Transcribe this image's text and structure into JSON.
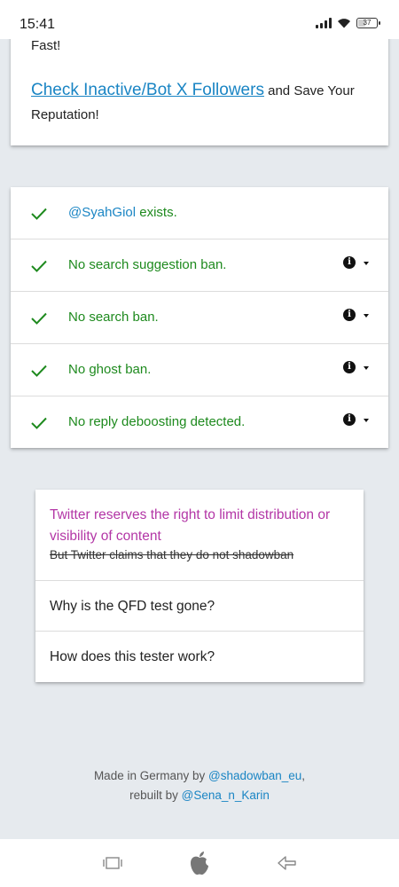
{
  "status_bar": {
    "time": "15:41",
    "battery": "37"
  },
  "top_card": {
    "partial_text": "Fast!",
    "link_text": "Check Inactive/Bot X Followers",
    "link_suffix": " and Save Your Reputation!"
  },
  "results": {
    "exists": {
      "handle": "@SyahGiol",
      "text": " exists."
    },
    "items": [
      {
        "label": "No search suggestion ban."
      },
      {
        "label": "No search ban."
      },
      {
        "label": "No ghost ban."
      },
      {
        "label": "No reply deboosting detected."
      }
    ]
  },
  "faq": {
    "first_title": "Twitter reserves the right to limit distribution or visibility of content",
    "first_strike": "But Twitter claims that they do not shadowban",
    "q2": "Why is the QFD test gone?",
    "q3": "How does this tester work?"
  },
  "footer": {
    "made_prefix": "Made in Germany by ",
    "made_handle": "@shadowban_eu",
    "made_suffix": ",",
    "rebuilt_prefix": "rebuilt by ",
    "rebuilt_handle": "@Sena_n_Karin"
  },
  "colors": {
    "success": "#1e8a1e",
    "link": "#1a85c4",
    "faq_accent": "#b336a6",
    "background": "#e6eaee"
  },
  "icons": [
    "signal-icon",
    "wifi-icon",
    "battery-icon",
    "check-icon",
    "info-icon",
    "caret-down-icon",
    "recents-icon",
    "home-apple-icon",
    "back-icon"
  ]
}
